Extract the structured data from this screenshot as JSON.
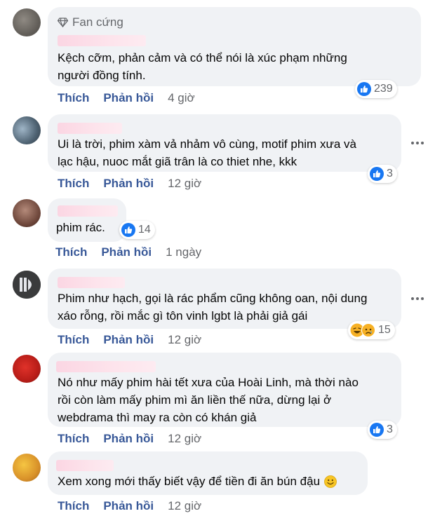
{
  "comments": [
    {
      "badge": "Fan cứng",
      "text": "Kệch cỡm, phản cảm và có thể nói là xúc phạm những\nngười đồng tính.",
      "reaction_count": "239",
      "reaction_icons": [
        "like-icon"
      ],
      "like_label": "Thích",
      "reply_label": "Phản hồi",
      "time": "4 giờ"
    },
    {
      "text": "Ui là trời, phim xàm vả nhảm vô cùng, motif phim xưa và\nlạc hậu, nuoc mắt giã trân là co thiet nhe, kkk",
      "reaction_count": "3",
      "reaction_icons": [
        "like-icon"
      ],
      "like_label": "Thích",
      "reply_label": "Phản hồi",
      "time": "12 giờ"
    },
    {
      "text": "phim rác.",
      "reaction_count": "14",
      "reaction_icons": [
        "like-icon"
      ],
      "like_label": "Thích",
      "reply_label": "Phản hồi",
      "time": "1 ngày"
    },
    {
      "text": "Phim như hạch, gọi là rác phẩm cũng không oan, nội dung\nxáo rỗng, rồi mắc gì tôn vinh lgbt là phải giả gái",
      "reaction_count": "15",
      "reaction_icons": [
        "haha-icon",
        "sad-icon"
      ],
      "like_label": "Thích",
      "reply_label": "Phản hồi",
      "time": "12 giờ"
    },
    {
      "text": "Nó như mấy phim hài tết xưa của Hoài Linh, mà thời nào\nrồi còn làm mấy phim mì ăn liền thế nữa, dừng lại ở\nwebdrama thì may ra còn có khán giả",
      "reaction_count": "3",
      "reaction_icons": [
        "like-icon"
      ],
      "like_label": "Thích",
      "reply_label": "Phản hồi",
      "time": "12 giờ"
    },
    {
      "text": "Xem xong mới thấy biết vậy để tiền đi ăn bún đậu",
      "emoji": "smile-emoji",
      "like_label": "Thích",
      "reply_label": "Phản hồi",
      "time": "12 giờ"
    }
  ],
  "colors": {
    "bubble": "#f0f2f5",
    "action_link": "#385898",
    "muted": "#65676b",
    "like_blue": "#1877f2",
    "name_blur": "#fbd6e3"
  }
}
